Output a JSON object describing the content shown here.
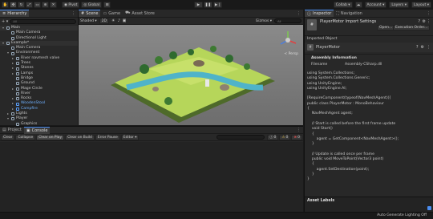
{
  "toolbar": {
    "tools": [
      "hand-icon",
      "move-icon",
      "rotate-icon",
      "scale-icon",
      "rect-icon",
      "transform-icon",
      "custom-icon"
    ],
    "pivot_label": "Pivot",
    "global_label": "Global",
    "collab_label": "Collab ▾",
    "account_label": "Account",
    "layers_label": "Layers",
    "layout_label": "Layout"
  },
  "hierarchy": {
    "tab_label": "Hierarchy",
    "search_placeholder": "All",
    "items": [
      {
        "label": "Main",
        "depth": 0,
        "arrow": "▾",
        "blue": false
      },
      {
        "label": "Main Camera",
        "depth": 1,
        "arrow": "",
        "blue": false
      },
      {
        "label": "Directional Light",
        "depth": 1,
        "arrow": "",
        "blue": false
      },
      {
        "label": "Example*",
        "depth": 0,
        "arrow": "▾",
        "blue": false
      },
      {
        "label": "Main Camera",
        "depth": 1,
        "arrow": "",
        "blue": false
      },
      {
        "label": "Environment",
        "depth": 1,
        "arrow": "▾",
        "blue": false
      },
      {
        "label": "River navmesh valve",
        "depth": 2,
        "arrow": "▸",
        "blue": false
      },
      {
        "label": "Trees",
        "depth": 2,
        "arrow": "▸",
        "blue": false
      },
      {
        "label": "Stones",
        "depth": 2,
        "arrow": "▸",
        "blue": false
      },
      {
        "label": "Lamps",
        "depth": 2,
        "arrow": "▸",
        "blue": false
      },
      {
        "label": "Bridge",
        "depth": 2,
        "arrow": "",
        "blue": false
      },
      {
        "label": "Ground",
        "depth": 2,
        "arrow": "",
        "blue": false
      },
      {
        "label": "Mage Circle",
        "depth": 2,
        "arrow": "▸",
        "blue": false
      },
      {
        "label": "River",
        "depth": 2,
        "arrow": "",
        "blue": false
      },
      {
        "label": "Rocks",
        "depth": 2,
        "arrow": "▸",
        "blue": false
      },
      {
        "label": "WoodenStool",
        "depth": 2,
        "arrow": "▸",
        "blue": true
      },
      {
        "label": "Campfire",
        "depth": 2,
        "arrow": "▸",
        "blue": true
      },
      {
        "label": "Lights",
        "depth": 1,
        "arrow": "▸",
        "blue": false
      },
      {
        "label": "Player",
        "depth": 1,
        "arrow": "▾",
        "blue": false
      },
      {
        "label": "Graphics",
        "depth": 2,
        "arrow": "",
        "blue": false
      }
    ]
  },
  "scene": {
    "tabs": [
      "Scene",
      "Game",
      "Asset Store"
    ],
    "shading_label": "Shaded",
    "mode_2d": "2D",
    "gizmos_label": "Gizmos ▾",
    "search_placeholder": "All",
    "persp_label": "< Persp"
  },
  "inspector": {
    "tabs": [
      "Inspector",
      "Navigation"
    ],
    "title": "PlayerMotor Import Settings",
    "open_button": "Open...",
    "exec_order_button": "Execution Order...",
    "imported_object_label": "Imported Object",
    "object_name": "PlayerMotor",
    "assembly_info_label": "Assembly Information",
    "filename_label": "Filename",
    "filename_value": "Assembly-CSharp.dll",
    "code_lines": [
      "using System.Collections;",
      "using System.Collections.Generic;",
      "using UnityEngine;",
      "using UnityEngine.AI;",
      "",
      "[RequireComponent(typeof(NavMeshAgent))]",
      "public class PlayerMotor : MonoBehaviour",
      "{",
      "    NavMeshAgent agent;",
      "",
      "    // Start is called before the first frame update",
      "    void Start()",
      "    {",
      "        agent = GetComponent<NavMeshAgent>();",
      "    }",
      "",
      "    // Update is called once per frame",
      "    public void MoveToPoint(Vector3 point)",
      "    {",
      "        agent.SetDestination(point);",
      "    }",
      "}"
    ],
    "asset_labels": "Asset Labels"
  },
  "console": {
    "tabs": [
      "Project",
      "Console"
    ],
    "buttons": [
      "Clear",
      "Collapse",
      "Clear on Play",
      "Clear on Build",
      "Error Pause",
      "Editor ▾"
    ],
    "counts": [
      "0",
      "0",
      "0"
    ]
  },
  "status": {
    "text": "Auto Generate Lighting Off"
  },
  "colors": {
    "accent": "#4a8df0",
    "panel": "#282828",
    "dark": "#191919",
    "scene_sky": "#7d7d7d",
    "terrain": "#b7d85a",
    "river": "#4fb3c9"
  }
}
